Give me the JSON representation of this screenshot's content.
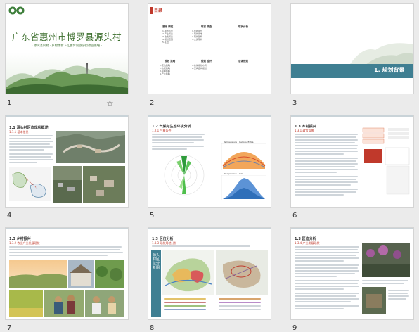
{
  "slides": [
    {
      "number": "1",
      "title": "广东省惠州市博罗县源头村",
      "subtitle": "- 源头温泉村 · 乡村更新下红色休闲旅游街改造策略 -"
    },
    {
      "number": "2",
      "toc_title": "目录",
      "sections": [
        "基础 研究",
        "现状 调查",
        "现状分析",
        "规划 策略",
        "规划 设计",
        "总体规划"
      ],
      "items": [
        [
          "1.规划背景",
          "2.产业解读",
          "3.政策解读",
          "4.规划范围",
          "5.区位"
        ],
        [
          "1.现状区位",
          "2.现状用地",
          "3.现状建筑",
          "4.交通现状"
        ],
        [
          "1.优势分析",
          "2.劣势分析",
          "3.机遇分析"
        ],
        [
          "1.定位策略",
          "2.功能策略",
          "3.风貌策略",
          "4.产业策略"
        ],
        [
          "1.总体规划布局",
          "2.空间结构规划"
        ],
        [
          "1.总体布局",
          "2.节点设计"
        ]
      ]
    },
    {
      "number": "3",
      "section_label": "1. 规划背景"
    },
    {
      "number": "4",
      "heading": "1.1 源头村区位现状概述",
      "sub": "1.1.1 基本信息"
    },
    {
      "number": "5",
      "heading": "1.2 气候与生态环境分析",
      "sub": "1.2.1 气象条件",
      "chart1_title": "Temperature - Celsius, Extra",
      "chart2_title": "Precipitation - mm"
    },
    {
      "number": "6",
      "heading": "1.3 乡村振兴",
      "sub": "1.3.1 政策背景"
    },
    {
      "number": "7",
      "heading": "1.3 乡村振兴",
      "sub": "1.3.2 农业产业发展现状"
    },
    {
      "number": "8",
      "heading": "1.3 区位分析",
      "sub": "1.3.3 现状用地分析",
      "vertical_text": "源头村区位分析图"
    },
    {
      "number": "9",
      "heading": "1.3 区位分析",
      "sub": "1.3.4 产业发展现状"
    }
  ],
  "ui": {
    "star_icon": "star-outline-icon"
  },
  "colors": {
    "teal": "#3f7f92",
    "green": "#4e8a3a",
    "red": "#c0392b"
  }
}
